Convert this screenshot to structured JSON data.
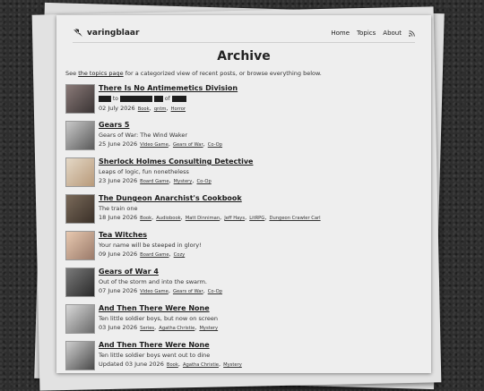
{
  "site": {
    "name": "varingblaar",
    "icon": "wings-logo-icon"
  },
  "nav": {
    "home": "Home",
    "topics": "Topics",
    "about": "About",
    "rss_icon": "rss-icon"
  },
  "page": {
    "title": "Archive",
    "intro_before": "See ",
    "intro_link": "the topics page",
    "intro_after": " for a categorized view of recent posts, or browse everything below."
  },
  "entries": [
    {
      "title": "There Is No Antimemetics Division",
      "subtitle_redacted": true,
      "subtitle_parts": [
        "to",
        "of"
      ],
      "date": "02 July 2026",
      "tags": [
        "Book",
        "qntm",
        "Horror"
      ],
      "thumb_colors": [
        "#8a7a78",
        "#3a3434"
      ]
    },
    {
      "title": "Gears 5",
      "subtitle": "Gears of War: The Wind Waker",
      "date": "25 June 2026",
      "tags": [
        "Video Game",
        "Gears of War",
        "Co-Op"
      ],
      "thumb_colors": [
        "#c9c9c9",
        "#5a5a5a"
      ]
    },
    {
      "title": "Sherlock Holmes Consulting Detective",
      "subtitle": "Leaps of logic, fun nonetheless",
      "date": "23 June 2026",
      "tags": [
        "Board Game",
        "Mystery",
        "Co-Op"
      ],
      "thumb_colors": [
        "#e4d8c6",
        "#b89a7a"
      ]
    },
    {
      "title": "The Dungeon Anarchist's Cookbook",
      "subtitle": "The train one",
      "date": "18 June 2026",
      "tags": [
        "Book",
        "Audiobook",
        "Matt Dinniman",
        "Jeff Hays",
        "LitRPG",
        "Dungeon Crawler Carl"
      ],
      "thumb_colors": [
        "#7a6a5a",
        "#3a3028"
      ]
    },
    {
      "title": "Tea Witches",
      "subtitle": "Your name will be steeped in glory!",
      "date": "09 June 2026",
      "tags": [
        "Board Game",
        "Cozy"
      ],
      "thumb_colors": [
        "#e8c9b0",
        "#9a7a6a"
      ]
    },
    {
      "title": "Gears of War 4",
      "subtitle": "Out of the storm and into the swarm.",
      "date": "07 June 2026",
      "tags": [
        "Video Game",
        "Gears of War",
        "Co-Op"
      ],
      "thumb_colors": [
        "#7a7a7a",
        "#2a2a2a"
      ]
    },
    {
      "title": "And Then There Were None",
      "subtitle": "Ten little soldier boys, but now on screen",
      "date": "03 June 2026",
      "tags": [
        "Series",
        "Agatha Christie",
        "Mystery"
      ],
      "thumb_colors": [
        "#d8d8d8",
        "#6a6a6a"
      ]
    },
    {
      "title": "And Then There Were None",
      "subtitle": "Ten little soldier boys went out to dine",
      "date": "Updated 03 June 2026",
      "tags": [
        "Book",
        "Agatha Christie",
        "Mystery"
      ],
      "thumb_colors": [
        "#cfcfcf",
        "#4a4a4a"
      ]
    }
  ]
}
